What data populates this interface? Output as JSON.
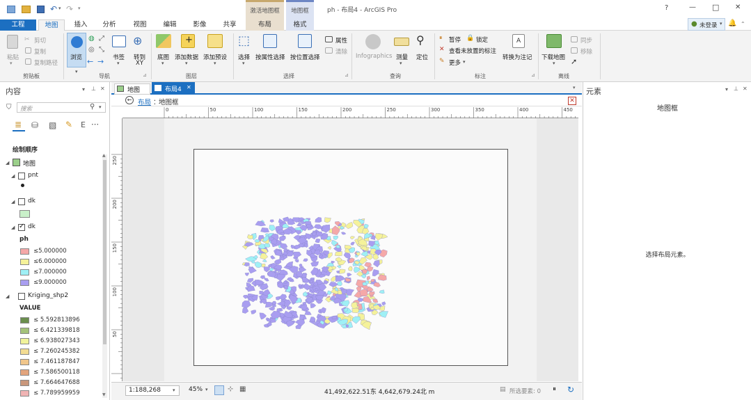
{
  "window": {
    "title": "ph - 布局4 - ArcGIS Pro",
    "context_tab_activate": "激活地图框",
    "context_tab_mapframe": "地图框",
    "help": "?",
    "minimize": "—",
    "maximize": "□",
    "close": "✕"
  },
  "tabs": {
    "project": "工程",
    "items": [
      "地图",
      "插入",
      "分析",
      "视图",
      "编辑",
      "影像",
      "共享",
      "布局",
      "格式"
    ]
  },
  "account": {
    "label": "未登录",
    "arrow": "▾"
  },
  "ribbon": {
    "clipboard": {
      "group": "剪贴板",
      "paste": "粘贴",
      "cut": "剪切",
      "copy": "复制",
      "copy_path": "复制路径"
    },
    "navigate": {
      "group": "导航",
      "explore": "浏览",
      "bookmarks": "书签",
      "goto_xy_1": "转到",
      "goto_xy_2": "XY"
    },
    "layer": {
      "group": "图层",
      "basemap": "底图",
      "add_data": "添加数据",
      "add_preset": "添加预设"
    },
    "selection": {
      "group": "选择",
      "select": "选择",
      "by_attr": "按属性选择",
      "by_location": "按位置选择",
      "attributes": "属性",
      "clear": "清除"
    },
    "inquiry": {
      "group": "查询",
      "infographics": "Infographics",
      "measure": "测量",
      "locate": "定位"
    },
    "labeling": {
      "group": "标注",
      "pause": "暂停",
      "lock": "锁定",
      "unplaced": "查看未放置的标注",
      "more": "更多",
      "convert": "转换为注记"
    },
    "offline": {
      "group": "离线",
      "download": "下载地图",
      "sync": "同步",
      "remove": "移除"
    }
  },
  "contents": {
    "title": "内容",
    "search_placeholder": "搜索",
    "drawing_order": "绘制顺序",
    "map": "地图",
    "layers": [
      {
        "name": "pnt"
      },
      {
        "name": "dk"
      },
      {
        "name": "dk",
        "field": "ph",
        "classes": [
          "≤5.000000",
          "≤6.000000",
          "≤7.000000",
          "≤9.000000"
        ]
      },
      {
        "name": "Kriging_shp2",
        "field": "VALUE",
        "classes": [
          "≤ 5.592813896",
          "≤ 6.421339818",
          "≤ 6.938027343",
          "≤ 7.260245382",
          "≤ 7.461187847",
          "≤ 7.586500118",
          "≤ 7.664647688",
          "≤ 7.789959959"
        ]
      }
    ]
  },
  "doc_tabs": {
    "map": "地图",
    "layout": "布局4",
    "close": "✕"
  },
  "breadcrumb": {
    "layout": "布局",
    "sep": "：",
    "frame": "地图框"
  },
  "ruler": {
    "h": [
      "0",
      "50",
      "100",
      "150",
      "200",
      "250",
      "300",
      "350",
      "400",
      "450"
    ],
    "v": [
      "250",
      "200",
      "150",
      "100",
      "50"
    ]
  },
  "statusbar": {
    "scale": "1:188,268",
    "zoom": "45%",
    "coords": "41,492,622.51东 4,642,679.24北 m",
    "selected": "所选要素: 0"
  },
  "element_pane": {
    "title": "元素",
    "heading": "地图框",
    "hint": "选择布局元素。"
  },
  "colors": {
    "blue": "#1c6fc1",
    "purple": "#a99ef0",
    "cyan": "#9ff0f5",
    "yellow": "#f5f29a",
    "salmon": "#f5a8a8",
    "context_activate": "#e9dfcf",
    "context_format": "#dce3f3"
  },
  "legend_colors": {
    "ph": [
      "#f5a8a8",
      "#f5f29a",
      "#9ff0f5",
      "#a99ef0"
    ],
    "kriging": [
      "#6b8f4e",
      "#a4c27a",
      "#f1f39b",
      "#f3dc93",
      "#f0c68b",
      "#e3a57d",
      "#c9977c",
      "#f0b4b4"
    ]
  }
}
